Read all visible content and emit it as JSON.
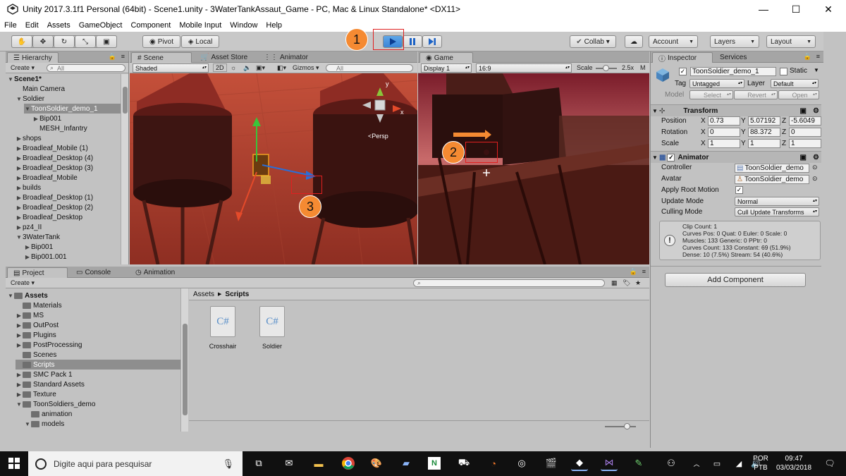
{
  "window": {
    "title": "Unity 2017.3.1f1 Personal (64bit) - Scene1.unity - 3WaterTankAssaut_Game - PC, Mac & Linux Standalone* <DX11>",
    "minimize": "—",
    "maximize": "☐",
    "close": "✕"
  },
  "menu": [
    "File",
    "Edit",
    "Assets",
    "GameObject",
    "Component",
    "Mobile Input",
    "Window",
    "Help"
  ],
  "toolbar": {
    "pivot": "Pivot",
    "local": "Local",
    "collab": "Collab ▾",
    "account": "Account",
    "layers": "Layers",
    "layout": "Layout",
    "callout1": "1",
    "callout2": "2",
    "callout3": "3"
  },
  "hierarchy": {
    "tab": "Hierarchy",
    "create": "Create ▾",
    "search": "All",
    "items": [
      {
        "label": "Scene1*",
        "depth": 0,
        "arrow": "▼",
        "bold": true
      },
      {
        "label": "Main Camera",
        "depth": 1,
        "arrow": ""
      },
      {
        "label": "Soldier",
        "depth": 1,
        "arrow": "▼"
      },
      {
        "label": "ToonSoldier_demo_1",
        "depth": 2,
        "arrow": "▼",
        "selected": true
      },
      {
        "label": "Bip001",
        "depth": 3,
        "arrow": "▶"
      },
      {
        "label": "MESH_Infantry",
        "depth": 3,
        "arrow": ""
      },
      {
        "label": "shops",
        "depth": 1,
        "arrow": "▶"
      },
      {
        "label": "Broadleaf_Mobile (1)",
        "depth": 1,
        "arrow": "▶"
      },
      {
        "label": "Broadleaf_Desktop (4)",
        "depth": 1,
        "arrow": "▶"
      },
      {
        "label": "Broadleaf_Desktop (3)",
        "depth": 1,
        "arrow": "▶"
      },
      {
        "label": "Broadleaf_Mobile",
        "depth": 1,
        "arrow": "▶"
      },
      {
        "label": "builds",
        "depth": 1,
        "arrow": "▶"
      },
      {
        "label": "Broadleaf_Desktop (1)",
        "depth": 1,
        "arrow": "▶"
      },
      {
        "label": "Broadleaf_Desktop (2)",
        "depth": 1,
        "arrow": "▶"
      },
      {
        "label": "Broadleaf_Desktop",
        "depth": 1,
        "arrow": "▶"
      },
      {
        "label": "pz4_II",
        "depth": 1,
        "arrow": "▶"
      },
      {
        "label": "3WaterTank",
        "depth": 1,
        "arrow": "▼"
      },
      {
        "label": "Bip001",
        "depth": 2,
        "arrow": "▶"
      },
      {
        "label": "Bip001.001",
        "depth": 2,
        "arrow": "▶"
      }
    ]
  },
  "scene": {
    "tabs": [
      "Scene",
      "Asset Store",
      "Animator"
    ],
    "shaded": "Shaded",
    "mode2d": "2D",
    "gizmos": "Gizmos ▾",
    "search": "All",
    "persp": "<Persp"
  },
  "game": {
    "tab": "Game",
    "display": "Display 1",
    "aspect": "16:9",
    "scale_label": "Scale",
    "scale_value": "2.5x"
  },
  "inspector": {
    "tabs": [
      "Inspector",
      "Services"
    ],
    "object_name": "ToonSoldier_demo_1",
    "static_label": "Static",
    "tag_label": "Tag",
    "tag_value": "Untagged",
    "layer_label": "Layer",
    "layer_value": "Default",
    "model_label": "Model",
    "model_buttons": [
      "Select",
      "Revert",
      "Open"
    ],
    "transform": {
      "title": "Transform",
      "position": {
        "label": "Position",
        "x": "0.73",
        "y": "5.07192",
        "z": "-5.6049"
      },
      "rotation": {
        "label": "Rotation",
        "x": "0",
        "y": "88.372",
        "z": "0"
      },
      "scale": {
        "label": "Scale",
        "x": "1",
        "y": "1",
        "z": "1"
      }
    },
    "animator": {
      "title": "Animator",
      "controller_label": "Controller",
      "controller_value": "ToonSoldier_demo",
      "avatar_label": "Avatar",
      "avatar_value": "ToonSoldier_demo",
      "apply_root_label": "Apply Root Motion",
      "update_mode_label": "Update Mode",
      "update_mode_value": "Normal",
      "culling_label": "Culling Mode",
      "culling_value": "Cull Update Transforms",
      "info": [
        "Clip Count: 1",
        "Curves Pos: 0 Quat: 0 Euler: 0 Scale: 0",
        "Muscles: 133 Generic: 0 PPtr: 0",
        "Curves Count: 133 Constant: 69 (51.9%)",
        "Dense: 10 (7.5%) Stream: 54 (40.6%)"
      ]
    },
    "add_component": "Add Component"
  },
  "project": {
    "tabs": [
      "Project",
      "Console",
      "Animation"
    ],
    "create": "Create ▾",
    "tree": [
      {
        "label": "Assets",
        "depth": 0,
        "arrow": "▼",
        "bold": true
      },
      {
        "label": "Materials",
        "depth": 1,
        "arrow": ""
      },
      {
        "label": "MS",
        "depth": 1,
        "arrow": "▶"
      },
      {
        "label": "OutPost",
        "depth": 1,
        "arrow": "▶"
      },
      {
        "label": "Plugins",
        "depth": 1,
        "arrow": "▶"
      },
      {
        "label": "PostProcessing",
        "depth": 1,
        "arrow": "▶"
      },
      {
        "label": "Scenes",
        "depth": 1,
        "arrow": ""
      },
      {
        "label": "Scripts",
        "depth": 1,
        "arrow": "",
        "selected": true
      },
      {
        "label": "SMC Pack 1",
        "depth": 1,
        "arrow": "▶"
      },
      {
        "label": "Standard Assets",
        "depth": 1,
        "arrow": "▶"
      },
      {
        "label": "Texture",
        "depth": 1,
        "arrow": "▶"
      },
      {
        "label": "ToonSoldiers_demo",
        "depth": 1,
        "arrow": "▼"
      },
      {
        "label": "animation",
        "depth": 2,
        "arrow": ""
      },
      {
        "label": "models",
        "depth": 2,
        "arrow": "▼"
      }
    ],
    "breadcrumb": [
      "Assets",
      "Scripts"
    ],
    "files": [
      {
        "name": "Crosshair",
        "icon": "C#"
      },
      {
        "name": "Soldier",
        "icon": "C#"
      }
    ]
  },
  "taskbar": {
    "search_placeholder": "Digite aqui para pesquisar",
    "lang1": "POR",
    "lang2": "PTB",
    "time": "09:47",
    "date": "03/03/2018"
  }
}
